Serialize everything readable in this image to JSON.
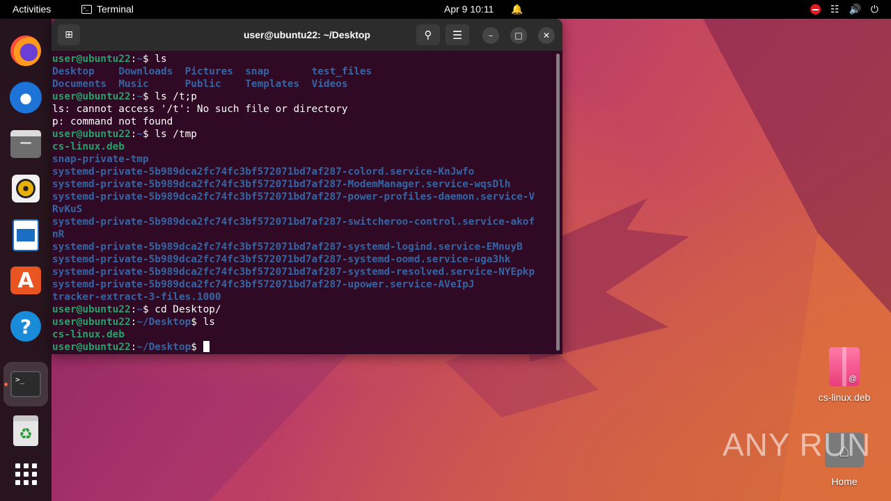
{
  "topbar": {
    "activities": "Activities",
    "app_name": "Terminal",
    "clock": "Apr 9  10:11"
  },
  "dock": {
    "items": [
      {
        "name": "Firefox",
        "icon": "firefox-icon"
      },
      {
        "name": "Thunderbird",
        "icon": "thunderbird-icon"
      },
      {
        "name": "Files",
        "icon": "files-icon"
      },
      {
        "name": "Rhythmbox",
        "icon": "rhythmbox-icon"
      },
      {
        "name": "LibreOffice Writer",
        "icon": "writer-icon"
      },
      {
        "name": "Ubuntu Software",
        "icon": "software-store-icon"
      },
      {
        "name": "Help",
        "icon": "help-icon"
      },
      {
        "name": "Terminal",
        "icon": "terminal-icon"
      },
      {
        "name": "Trash",
        "icon": "trash-icon"
      },
      {
        "name": "Show Applications",
        "icon": "app-grid-icon"
      }
    ]
  },
  "terminal": {
    "title": "user@ubuntu22: ~/Desktop",
    "prompt_user": "user@ubuntu22",
    "lines": [
      {
        "segs": [
          [
            "u",
            "user@ubuntu22"
          ],
          [
            "w",
            ":"
          ],
          [
            "p",
            "~"
          ],
          [
            "w",
            "$ ls"
          ]
        ]
      },
      {
        "segs": [
          [
            "b",
            "Desktop"
          ],
          [
            "w",
            "    "
          ],
          [
            "b",
            "Downloads"
          ],
          [
            "w",
            "  "
          ],
          [
            "b",
            "Pictures"
          ],
          [
            "w",
            "  "
          ],
          [
            "b",
            "snap"
          ],
          [
            "w",
            "       "
          ],
          [
            "b",
            "test_files"
          ]
        ]
      },
      {
        "segs": [
          [
            "b",
            "Documents"
          ],
          [
            "w",
            "  "
          ],
          [
            "b",
            "Music"
          ],
          [
            "w",
            "      "
          ],
          [
            "b",
            "Public"
          ],
          [
            "w",
            "    "
          ],
          [
            "b",
            "Templates"
          ],
          [
            "w",
            "  "
          ],
          [
            "b",
            "Videos"
          ]
        ]
      },
      {
        "segs": [
          [
            "u",
            "user@ubuntu22"
          ],
          [
            "w",
            ":"
          ],
          [
            "p",
            "~"
          ],
          [
            "w",
            "$ ls /t;p"
          ]
        ]
      },
      {
        "segs": [
          [
            "w",
            "ls: cannot access '/t': No such file or directory"
          ]
        ]
      },
      {
        "segs": [
          [
            "w",
            "p: command not found"
          ]
        ]
      },
      {
        "segs": [
          [
            "u",
            "user@ubuntu22"
          ],
          [
            "w",
            ":"
          ],
          [
            "p",
            "~"
          ],
          [
            "w",
            "$ ls /tmp"
          ]
        ]
      },
      {
        "segs": [
          [
            "g",
            "cs-linux.deb"
          ]
        ]
      },
      {
        "segs": [
          [
            "b",
            "snap-private-tmp"
          ]
        ]
      },
      {
        "segs": [
          [
            "b",
            "systemd-private-5b989dca2fc74fc3bf572071bd7af287-colord.service-KnJwfo"
          ]
        ]
      },
      {
        "segs": [
          [
            "b",
            "systemd-private-5b989dca2fc74fc3bf572071bd7af287-ModemManager.service-wqsDlh"
          ]
        ]
      },
      {
        "segs": [
          [
            "b",
            "systemd-private-5b989dca2fc74fc3bf572071bd7af287-power-profiles-daemon.service-V"
          ]
        ]
      },
      {
        "segs": [
          [
            "b",
            "RvKuS"
          ]
        ]
      },
      {
        "segs": [
          [
            "b",
            "systemd-private-5b989dca2fc74fc3bf572071bd7af287-switcheroo-control.service-akof"
          ]
        ]
      },
      {
        "segs": [
          [
            "b",
            "nR"
          ]
        ]
      },
      {
        "segs": [
          [
            "b",
            "systemd-private-5b989dca2fc74fc3bf572071bd7af287-systemd-logind.service-EMnuyB"
          ]
        ]
      },
      {
        "segs": [
          [
            "b",
            "systemd-private-5b989dca2fc74fc3bf572071bd7af287-systemd-oomd.service-uga3hk"
          ]
        ]
      },
      {
        "segs": [
          [
            "b",
            "systemd-private-5b989dca2fc74fc3bf572071bd7af287-systemd-resolved.service-NYEpkp"
          ]
        ]
      },
      {
        "segs": [
          [
            "b",
            "systemd-private-5b989dca2fc74fc3bf572071bd7af287-upower.service-AVeIpJ"
          ]
        ]
      },
      {
        "segs": [
          [
            "b",
            "tracker-extract-3-files.1000"
          ]
        ]
      },
      {
        "segs": [
          [
            "u",
            "user@ubuntu22"
          ],
          [
            "w",
            ":"
          ],
          [
            "p",
            "~"
          ],
          [
            "w",
            "$ cd Desktop/"
          ]
        ]
      },
      {
        "segs": [
          [
            "u",
            "user@ubuntu22"
          ],
          [
            "w",
            ":"
          ],
          [
            "p",
            "~/Desktop"
          ],
          [
            "w",
            "$ ls"
          ]
        ]
      },
      {
        "segs": [
          [
            "g",
            "cs-linux.deb"
          ]
        ]
      },
      {
        "segs": [
          [
            "u",
            "user@ubuntu22"
          ],
          [
            "w",
            ":"
          ],
          [
            "p",
            "~/Desktop"
          ],
          [
            "w",
            "$ "
          ]
        ],
        "cursor": true
      }
    ]
  },
  "desktop": {
    "icons": [
      {
        "label": "cs-linux.deb",
        "icon": "deb-package-icon"
      },
      {
        "label": "Home",
        "icon": "home-folder-icon"
      }
    ]
  },
  "watermark": "ANY   RUN",
  "colors": {
    "terminal_bg": "#300a24",
    "prompt_user": "#26a269",
    "prompt_path": "#3465a4",
    "accent": "#e95420"
  }
}
